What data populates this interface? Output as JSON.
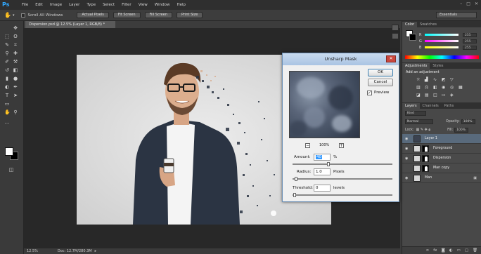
{
  "app": {
    "logo": "Ps"
  },
  "menubar": {
    "items": [
      "File",
      "Edit",
      "Image",
      "Layer",
      "Type",
      "Select",
      "Filter",
      "View",
      "Window",
      "Help"
    ]
  },
  "optionsbar": {
    "scroll_all_windows": "Scroll All Windows",
    "buttons": [
      "Actual Pixels",
      "Fit Screen",
      "Fill Screen",
      "Print Size"
    ],
    "workspace": "Essentials"
  },
  "document": {
    "tab_title": "Dispersion.psd @ 12.5% (Layer 1, RGB/8) *"
  },
  "status": {
    "zoom": "12.5%",
    "doc_info": "Doc: 12.7M/280.3M"
  },
  "color_panel": {
    "tabs": [
      "Color",
      "Swatches"
    ],
    "rows": [
      {
        "label": "R",
        "value": "255"
      },
      {
        "label": "G",
        "value": "255"
      },
      {
        "label": "B",
        "value": "255"
      }
    ]
  },
  "adjustments_panel": {
    "tabs": [
      "Adjustments",
      "Styles"
    ],
    "heading": "Add an adjustment"
  },
  "layers_panel": {
    "tabs": [
      "Layers",
      "Channels",
      "Paths"
    ],
    "kind": "Kind",
    "blend_mode": "Normal",
    "opacity_label": "Opacity:",
    "opacity_value": "100%",
    "lock_label": "Lock:",
    "fill_label": "Fill:",
    "fill_value": "100%",
    "layers": [
      {
        "name": "Layer 1"
      },
      {
        "name": "Foreground"
      },
      {
        "name": "Dispersion"
      },
      {
        "name": "Man copy"
      },
      {
        "name": "Man"
      }
    ]
  },
  "dialog": {
    "title": "Unsharp Mask",
    "ok": "OK",
    "cancel": "Cancel",
    "preview_label": "Preview",
    "preview_checked": true,
    "zoom": "100%",
    "amount_label": "Amount:",
    "amount_value": "40",
    "amount_unit": "%",
    "radius_label": "Radius:",
    "radius_value": "1.0",
    "radius_unit": "Pixels",
    "threshold_label": "Threshold:",
    "threshold_value": "0",
    "threshold_unit": "levels"
  }
}
